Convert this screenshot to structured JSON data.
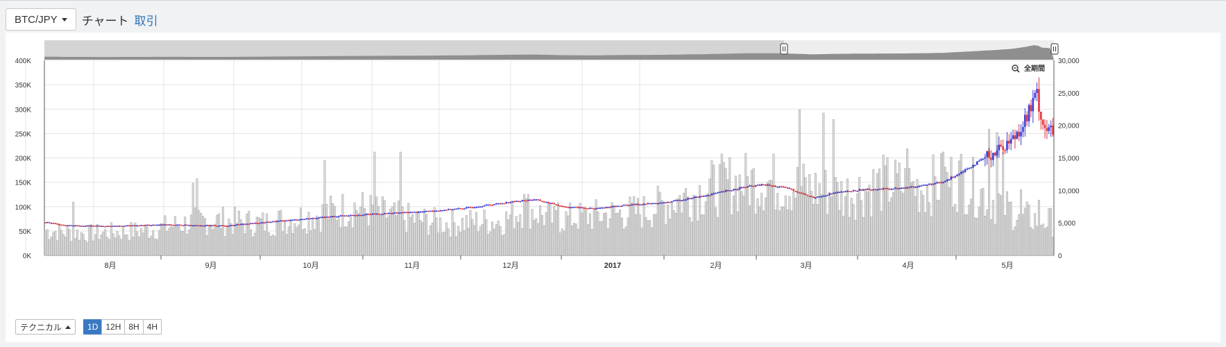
{
  "header": {
    "pair_label": "BTC/JPY",
    "tab_chart": "チャート",
    "tab_trade": "取引"
  },
  "chart": {
    "zoom_all_label": "全期間"
  },
  "bottom": {
    "technical_label": "テクニカル",
    "timeframes": [
      "1D",
      "12H",
      "8H",
      "4H"
    ],
    "active_timeframe": "1D"
  },
  "colors": {
    "up": "#3a3ad6",
    "down": "#e0333a",
    "volume_fill": "#dcdcdc",
    "volume_stroke": "#a9a9a9",
    "active_tab": "#3b78c2"
  },
  "chart_data": {
    "type": "candlestick",
    "x_tick_labels": [
      "8月",
      "9月",
      "10月",
      "11月",
      "12月",
      "2017",
      "2月",
      "3月",
      "4月",
      "5月"
    ],
    "price_axis": {
      "min": 0,
      "max": 400000,
      "ticks": [
        "0K",
        "50K",
        "100K",
        "150K",
        "200K",
        "250K",
        "300K",
        "350K",
        "400K"
      ]
    },
    "volume_axis": {
      "min": 0,
      "max": 30000,
      "ticks": [
        "0",
        "5,000",
        "10,000",
        "15,000",
        "20,000",
        "25,000",
        "30,000"
      ]
    },
    "price_anchors": [
      [
        0,
        68000
      ],
      [
        10,
        62000
      ],
      [
        30,
        60000
      ],
      [
        60,
        63000
      ],
      [
        90,
        61000
      ],
      [
        110,
        68000
      ],
      [
        130,
        75000
      ],
      [
        150,
        82000
      ],
      [
        170,
        86000
      ],
      [
        190,
        90000
      ],
      [
        210,
        97000
      ],
      [
        230,
        108000
      ],
      [
        245,
        115000
      ],
      [
        260,
        100000
      ],
      [
        275,
        96000
      ],
      [
        290,
        103000
      ],
      [
        310,
        108000
      ],
      [
        330,
        122000
      ],
      [
        350,
        140000
      ],
      [
        360,
        145000
      ],
      [
        372,
        138000
      ],
      [
        385,
        118000
      ],
      [
        395,
        128000
      ],
      [
        410,
        135000
      ],
      [
        430,
        138000
      ],
      [
        450,
        150000
      ],
      [
        462,
        178000
      ],
      [
        475,
        210000
      ],
      [
        485,
        240000
      ],
      [
        492,
        285000
      ],
      [
        497,
        330000
      ],
      [
        500,
        268000
      ],
      [
        505,
        250000
      ]
    ],
    "volume_anchors": [
      [
        0,
        3800
      ],
      [
        20,
        3300
      ],
      [
        50,
        3800
      ],
      [
        80,
        5400
      ],
      [
        110,
        4900
      ],
      [
        140,
        6400
      ],
      [
        155,
        7400
      ],
      [
        175,
        5900
      ],
      [
        200,
        4900
      ],
      [
        230,
        5300
      ],
      [
        240,
        7400
      ],
      [
        255,
        5400
      ],
      [
        270,
        5900
      ],
      [
        300,
        6700
      ],
      [
        320,
        8900
      ],
      [
        340,
        10900
      ],
      [
        360,
        11400
      ],
      [
        380,
        10400
      ],
      [
        400,
        9400
      ],
      [
        420,
        10900
      ],
      [
        440,
        10400
      ],
      [
        458,
        11900
      ],
      [
        470,
        9400
      ],
      [
        490,
        5900
      ],
      [
        505,
        5100
      ]
    ],
    "volume_spikes": [
      [
        14,
        8200
      ],
      [
        74,
        11100
      ],
      [
        76,
        11800
      ],
      [
        140,
        14600
      ],
      [
        165,
        15900
      ],
      [
        178,
        15900
      ],
      [
        240,
        9400
      ],
      [
        257,
        8100
      ],
      [
        378,
        22400
      ],
      [
        390,
        21900
      ],
      [
        395,
        20900
      ],
      [
        432,
        16400
      ],
      [
        450,
        15900
      ],
      [
        473,
        19400
      ],
      [
        477,
        18900
      ],
      [
        480,
        15900
      ],
      [
        489,
        10100
      ],
      [
        498,
        8500
      ]
    ],
    "candle_count": 506
  }
}
